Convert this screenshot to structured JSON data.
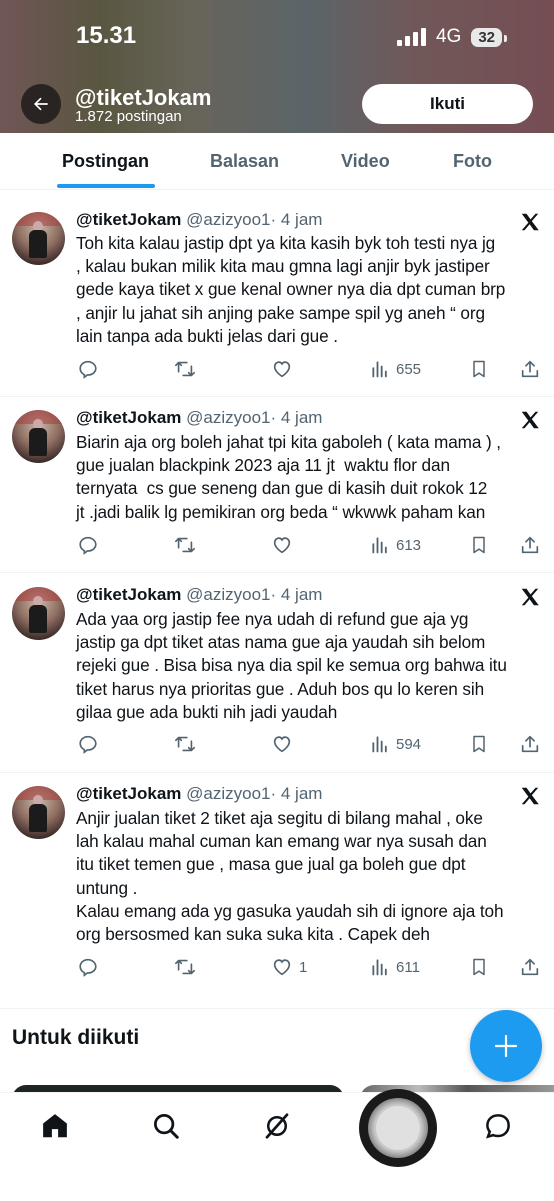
{
  "status_bar": {
    "time": "15.31",
    "network": "4G",
    "battery": "32"
  },
  "profile": {
    "name": "@tiketJokam",
    "post_count": "1.872 postingan",
    "follow_label": "Ikuti"
  },
  "tabs": [
    {
      "label": "Postingan",
      "active": true
    },
    {
      "label": "Balasan",
      "active": false
    },
    {
      "label": "Video",
      "active": false
    },
    {
      "label": "Foto",
      "active": false
    }
  ],
  "tweets": [
    {
      "name": "@tiketJokam",
      "handle": "@azizyoo1",
      "time": "· 4 jam",
      "text": "Toh kita kalau jastip dpt ya kita kasih byk toh testi nya jg\n, kalau bukan milik kita mau gmna lagi anjir byk jastiper\ngede kaya tiket x gue kenal owner nya dia dpt cuman brp\n, anjir lu jahat sih anjing pake sampe spil yg aneh “ org\nlain tanpa ada bukti jelas dari gue .",
      "likes": "",
      "views": "655"
    },
    {
      "name": "@tiketJokam",
      "handle": "@azizyoo1",
      "time": "· 4 jam",
      "text": "Biarin aja org boleh jahat tpi kita gaboleh ( kata mama ) ,\ngue jualan blackpink 2023 aja 11 jt  waktu flor dan\nternyata  cs gue seneng dan gue di kasih duit rokok 12\njt .jadi balik lg pemikiran org beda “ wkwwk paham kan",
      "likes": "",
      "views": "613"
    },
    {
      "name": "@tiketJokam",
      "handle": "@azizyoo1",
      "time": "· 4 jam",
      "text": "Ada yaa org jastip fee nya udah di refund gue aja yg\njastip ga dpt tiket atas nama gue aja yaudah sih belom\nrejeki gue . Bisa bisa nya dia spil ke semua org bahwa itu\ntiket harus nya prioritas gue . Aduh bos qu lo keren sih\ngilaa gue ada bukti nih jadi yaudah",
      "likes": "",
      "views": "594"
    },
    {
      "name": "@tiketJokam",
      "handle": "@azizyoo1",
      "time": "· 4 jam",
      "text": "Anjir jualan tiket 2 tiket aja segitu di bilang mahal , oke\nlah kalau mahal cuman kan emang war nya susah dan\nitu tiket temen gue , masa gue jual ga boleh gue dpt\nuntung .\nKalau emang ada yg gasuka yaudah sih di ignore aja toh\norg bersosmed kan suka suka kita . Capek deh",
      "likes": "1",
      "views": "611"
    }
  ],
  "suggestions": {
    "title": "Untuk diikuti"
  },
  "colors": {
    "accent": "#1d9bf0",
    "text": "#0f1419",
    "muted": "#536471"
  },
  "nav": [
    "home-icon",
    "search-icon",
    "grok-icon",
    "notifications-icon",
    "messages-icon"
  ]
}
